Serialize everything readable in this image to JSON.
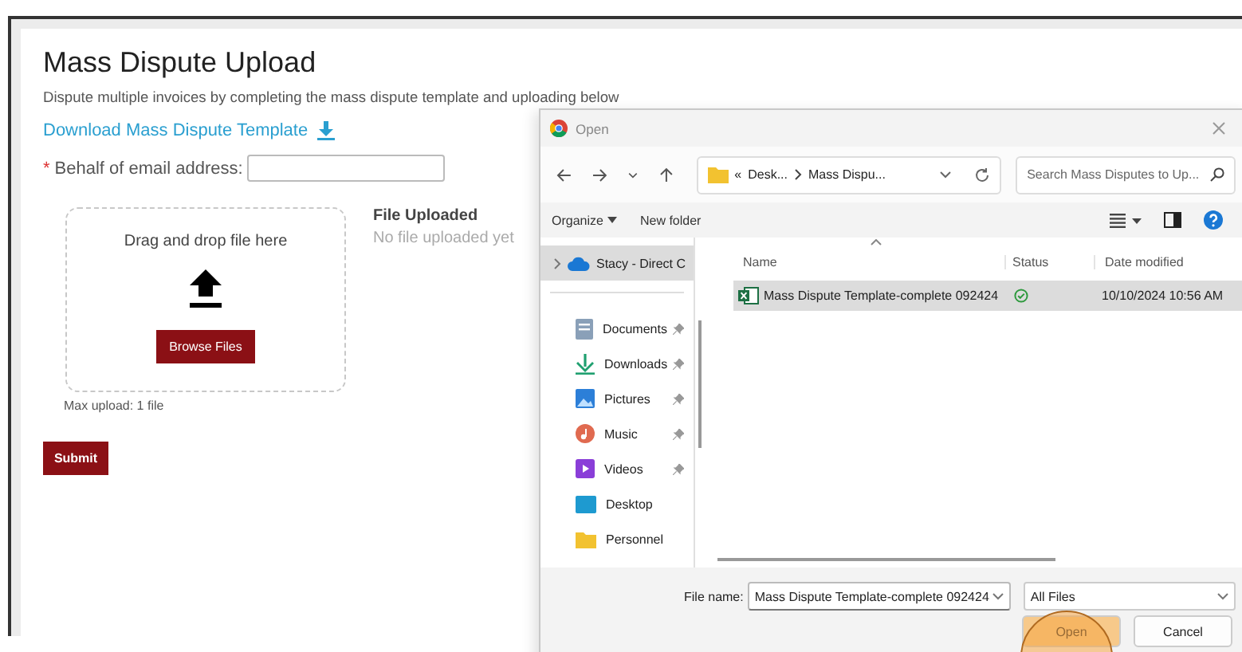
{
  "page": {
    "title": "Mass Dispute Upload",
    "description": "Dispute multiple invoices by completing the mass dispute template and uploading below",
    "download_link": "Download Mass Dispute Template",
    "email_field": {
      "required_mark": "*",
      "label": "Behalf of email address:"
    },
    "dropzone": {
      "prompt": "Drag and drop file here",
      "button": "Browse Files",
      "limit": "Max upload: 1 file"
    },
    "file_uploaded": {
      "heading": "File Uploaded",
      "status": "No file uploaded yet"
    },
    "submit": "Submit"
  },
  "dialog": {
    "title": "Open",
    "address": {
      "prefix": "«",
      "segments": [
        "Desk...",
        "Mass Dispu..."
      ]
    },
    "search_placeholder": "Search Mass Disputes to Up...",
    "toolbar": [
      "Organize",
      "New folder"
    ],
    "nav": [
      {
        "label": "Stacy - Direct C",
        "kind": "cloud",
        "selected": true,
        "pinned": false
      },
      {
        "label": "Documents",
        "kind": "documents",
        "selected": false,
        "pinned": true
      },
      {
        "label": "Downloads",
        "kind": "downloads",
        "selected": false,
        "pinned": true
      },
      {
        "label": "Pictures",
        "kind": "pictures",
        "selected": false,
        "pinned": true
      },
      {
        "label": "Music",
        "kind": "music",
        "selected": false,
        "pinned": true
      },
      {
        "label": "Videos",
        "kind": "videos",
        "selected": false,
        "pinned": true
      },
      {
        "label": "Desktop",
        "kind": "desktop",
        "selected": false,
        "pinned": false
      },
      {
        "label": "Personnel",
        "kind": "folder",
        "selected": false,
        "pinned": false
      }
    ],
    "columns": [
      "Name",
      "Status",
      "Date modified"
    ],
    "files": [
      {
        "name": "Mass Dispute Template-complete 092424",
        "synced": true,
        "date": "10/10/2024 10:56 AM",
        "selected": true
      }
    ],
    "file_name_label": "File name:",
    "file_name": "Mass Dispute Template-complete 092424",
    "filter": "All Files",
    "buttons": [
      {
        "label": "Open",
        "highlighted": true
      },
      {
        "label": "Cancel",
        "highlighted": false
      }
    ]
  }
}
